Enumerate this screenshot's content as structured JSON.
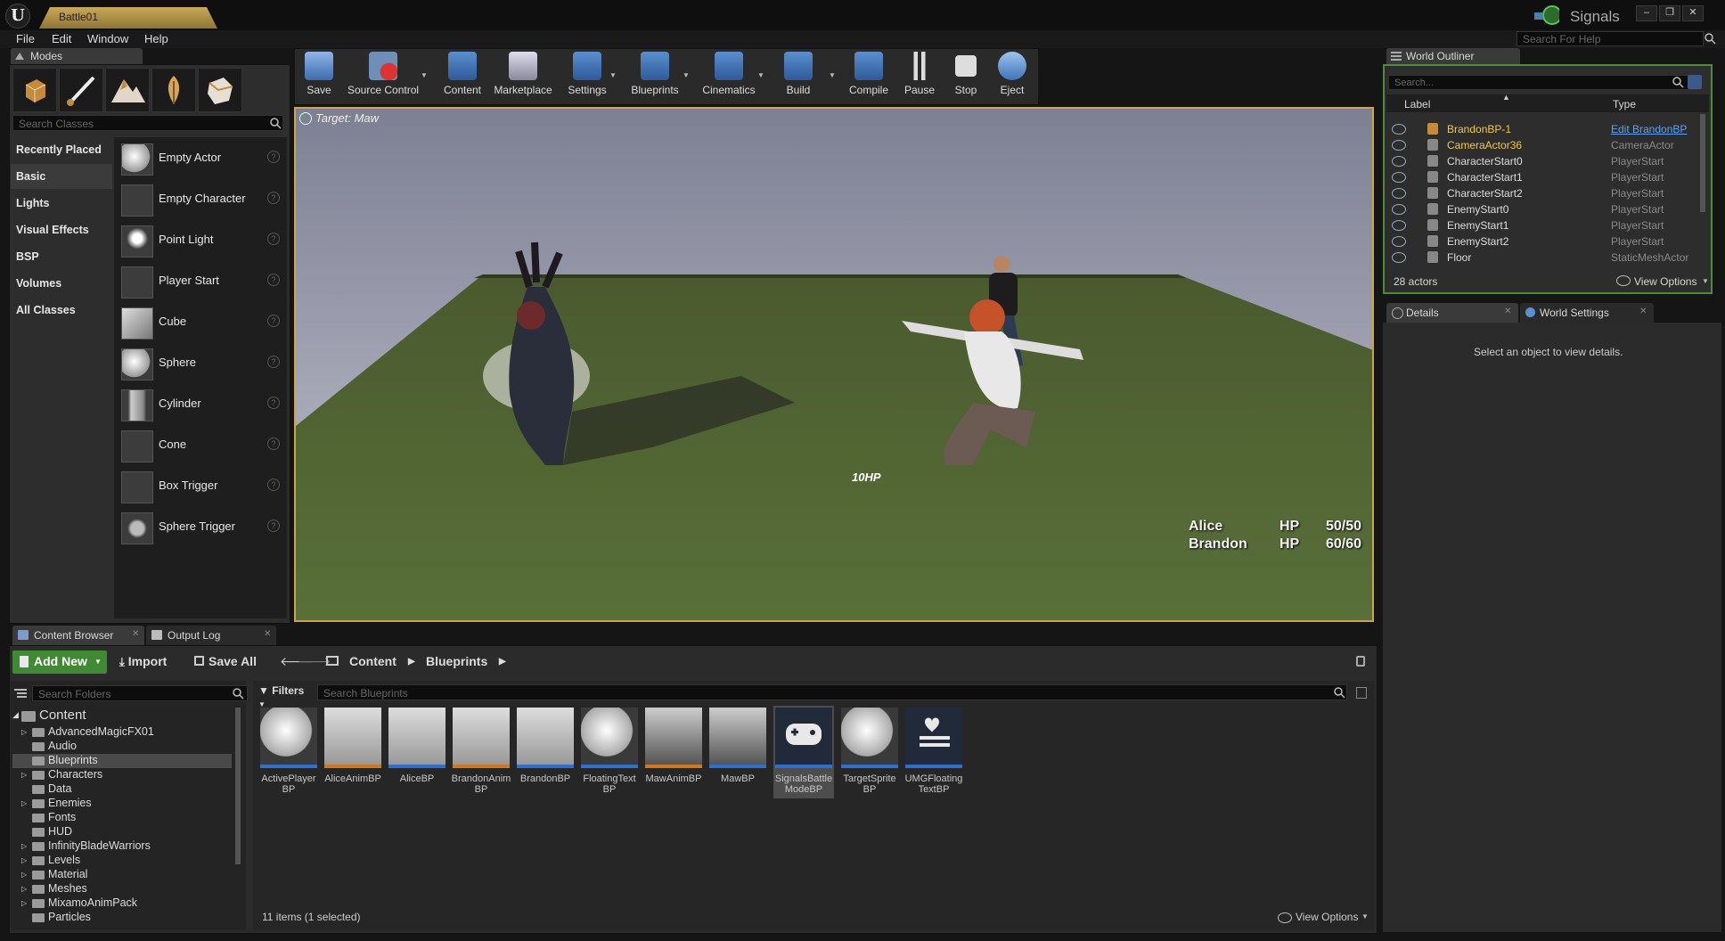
{
  "window": {
    "doc_tab": "Battle01",
    "project": "Signals"
  },
  "menu": [
    "File",
    "Edit",
    "Window",
    "Help"
  ],
  "help_search": {
    "placeholder": "Search For Help"
  },
  "modes": {
    "tab_label": "Modes",
    "search_placeholder": "Search Classes",
    "categories": [
      "Recently Placed",
      "Basic",
      "Lights",
      "Visual Effects",
      "BSP",
      "Volumes",
      "All Classes"
    ],
    "selected_category": "Basic",
    "classes": [
      "Empty Actor",
      "Empty Character",
      "Point Light",
      "Player Start",
      "Cube",
      "Sphere",
      "Cylinder",
      "Cone",
      "Box Trigger",
      "Sphere Trigger"
    ]
  },
  "toolbar": {
    "buttons": [
      "Save",
      "Source Control",
      "Content",
      "Marketplace",
      "Settings",
      "Blueprints",
      "Cinematics",
      "Build",
      "Compile",
      "Pause",
      "Stop",
      "Eject"
    ]
  },
  "viewport": {
    "target_label": "Target: Maw",
    "floating_text": "10HP",
    "party": [
      {
        "name": "Alice",
        "hp_label": "HP",
        "hp": "50/50"
      },
      {
        "name": "Brandon",
        "hp_label": "HP",
        "hp": "60/60"
      }
    ]
  },
  "outliner": {
    "tab_label": "World Outliner",
    "search_placeholder": "Search...",
    "col_label": "Label",
    "col_type": "Type",
    "rows": [
      {
        "name": "BrandonBP-1",
        "type": "Edit BrandonBP"
      },
      {
        "name": "CameraActor36",
        "type": "CameraActor"
      },
      {
        "name": "CharacterStart0",
        "type": "PlayerStart"
      },
      {
        "name": "CharacterStart1",
        "type": "PlayerStart"
      },
      {
        "name": "CharacterStart2",
        "type": "PlayerStart"
      },
      {
        "name": "EnemyStart0",
        "type": "PlayerStart"
      },
      {
        "name": "EnemyStart1",
        "type": "PlayerStart"
      },
      {
        "name": "EnemyStart2",
        "type": "PlayerStart"
      },
      {
        "name": "Floor",
        "type": "StaticMeshActor"
      }
    ],
    "actor_count": "28 actors",
    "view_options": "View Options"
  },
  "details": {
    "tab_details": "Details",
    "tab_world_settings": "World Settings",
    "empty_message": "Select an object to view details."
  },
  "content_browser": {
    "tab_label": "Content Browser",
    "output_log_tab": "Output Log",
    "add_new": "Add New",
    "import": "Import",
    "save_all": "Save All",
    "path": [
      "Content",
      "Blueprints"
    ],
    "search_folders_placeholder": "Search Folders",
    "root_folder": "Content",
    "folders": [
      "AdvancedMagicFX01",
      "Audio",
      "Blueprints",
      "Characters",
      "Data",
      "Enemies",
      "Fonts",
      "HUD",
      "InfinityBladeWarriors",
      "Levels",
      "Material",
      "Meshes",
      "MixamoAnimPack",
      "Particles"
    ],
    "selected_folder": "Blueprints",
    "filters_label": "Filters",
    "search_assets_placeholder": "Search Blueprints",
    "assets": [
      {
        "line1": "ActivePlayer",
        "line2": "BP"
      },
      {
        "line1": "AliceAnimBP",
        "line2": ""
      },
      {
        "line1": "AliceBP",
        "line2": ""
      },
      {
        "line1": "BrandonAnim",
        "line2": "BP"
      },
      {
        "line1": "BrandonBP",
        "line2": ""
      },
      {
        "line1": "FloatingText",
        "line2": "BP"
      },
      {
        "line1": "MawAnimBP",
        "line2": ""
      },
      {
        "line1": "MawBP",
        "line2": ""
      },
      {
        "line1": "SignalsBattle",
        "line2": "ModeBP"
      },
      {
        "line1": "TargetSprite",
        "line2": "BP"
      },
      {
        "line1": "UMGFloating",
        "line2": "TextBP"
      }
    ],
    "selected_asset": "SignalsBattleModeBP",
    "items_count": "11 items (1 selected)",
    "view_options": "View Options"
  },
  "colors": {
    "accent_gold": "#c9a64a",
    "outliner_border": "#4d8a3a",
    "add_new_green": "#3f8a33",
    "asset_blue": "#2f6fd1",
    "outliner_highlight": "#f0c94a"
  }
}
